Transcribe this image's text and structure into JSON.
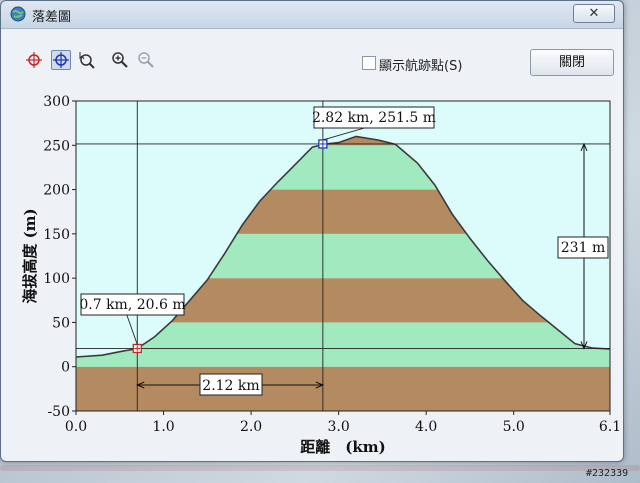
{
  "window": {
    "title": "落差圖",
    "close_glyph": "✕"
  },
  "toolbar": {
    "tools": [
      {
        "name": "add-point-tool-icon",
        "active": false
      },
      {
        "name": "select-point-tool-icon",
        "active": true
      },
      {
        "name": "pointer-zoom-tool-icon",
        "active": false
      },
      {
        "name": "zoom-in-icon",
        "active": false
      },
      {
        "name": "zoom-out-icon",
        "active": false
      }
    ],
    "show_waypoints_label": "顯示航跡點(S)",
    "show_waypoints_checked": false,
    "close_button_label": "關閉"
  },
  "chart_data": {
    "type": "area",
    "xlabel": "距離　(km)",
    "ylabel": "海拔高度 (m)",
    "xlim": [
      0.0,
      6.1
    ],
    "ylim": [
      -50,
      300
    ],
    "xticks": [
      "0.0",
      "1.0",
      "2.0",
      "3.0",
      "4.0",
      "5.0",
      "6.1"
    ],
    "yticks": [
      "-50",
      "0",
      "50",
      "100",
      "150",
      "200",
      "250",
      "300"
    ],
    "profile": {
      "x": [
        0.0,
        0.3,
        0.5,
        0.7,
        0.9,
        1.1,
        1.3,
        1.5,
        1.7,
        1.9,
        2.1,
        2.3,
        2.5,
        2.7,
        2.85,
        3.0,
        3.2,
        3.45,
        3.65,
        3.9,
        4.1,
        4.3,
        4.5,
        4.7,
        4.9,
        5.1,
        5.3,
        5.5,
        5.7,
        5.9,
        6.1
      ],
      "y": [
        11,
        13,
        17,
        20.6,
        34,
        52,
        75,
        98,
        128,
        160,
        187,
        208,
        228,
        248,
        251.5,
        253,
        260,
        256,
        251,
        230,
        205,
        172,
        145,
        120,
        97,
        75,
        58,
        42,
        26,
        21,
        20
      ]
    },
    "markers": [
      {
        "x": 0.7,
        "y": 20.6,
        "label": "0.7 km, 20.6 m",
        "color": "#cc2222"
      },
      {
        "x": 2.82,
        "y": 251.5,
        "label": "2.82 km, 251.5 m",
        "color": "#2233bb"
      }
    ],
    "annotations": {
      "horizontal_distance": "2.12 km",
      "vertical_difference": "231 m"
    },
    "colors": {
      "plot_background": "#dcfcfc",
      "band_light": "#a1eabf",
      "band_dark": "#b48a60",
      "profile_line": "#3a3a3a"
    }
  },
  "watermark": "#232339"
}
